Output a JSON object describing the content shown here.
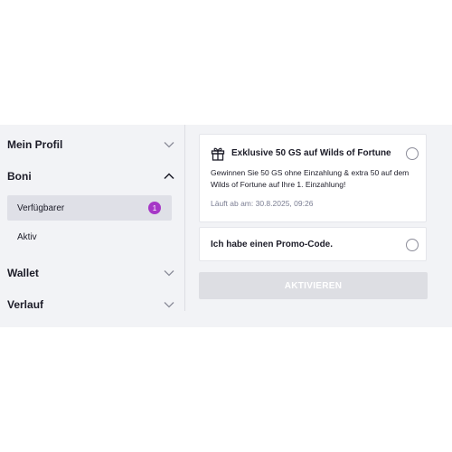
{
  "sidebar": {
    "items": [
      {
        "label": "Mein Profil"
      },
      {
        "label": "Boni"
      },
      {
        "label": "Wallet"
      },
      {
        "label": "Verlauf"
      }
    ],
    "boni_subitems": [
      {
        "label": "Verfügbarer",
        "badge": "1"
      },
      {
        "label": "Aktiv"
      }
    ]
  },
  "offers": {
    "bonus": {
      "title": "Exklusive 50 GS auf Wilds of Fortune",
      "description": "Gewinnen Sie 50 GS ohne Einzahlung & extra 50 auf dem Wilds of Fortune auf Ihre 1. Einzahlung!",
      "expires": "Läuft ab am: 30.8.2025, 09:26",
      "icon": "gift-icon"
    },
    "promo": {
      "label": "Ich habe einen Promo-Code."
    }
  },
  "actions": {
    "activate_label": "AKTIVIEREN"
  },
  "colors": {
    "accent_badge": "#a637c7",
    "panel_bg": "#f2f3f6",
    "button_disabled_bg": "#dddee3"
  }
}
